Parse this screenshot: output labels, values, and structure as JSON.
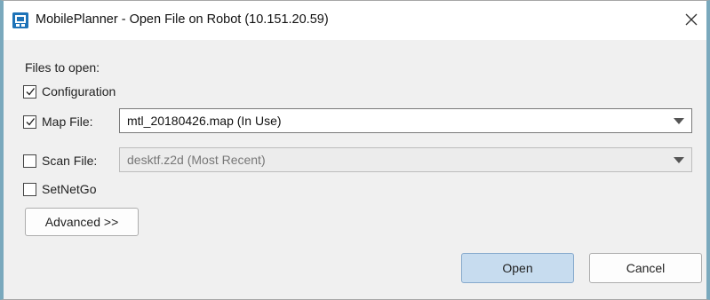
{
  "window": {
    "title": "MobilePlanner - Open File on Robot (10.151.20.59)",
    "close_glyph": "✕",
    "accent_color": "#7aa9bd",
    "app_icon": "mobileplanner-app-icon"
  },
  "form": {
    "files_label": "Files to open:",
    "configuration": {
      "label": "Configuration",
      "checked": true
    },
    "map_file": {
      "label": "Map File:",
      "checked": true,
      "value": "mtl_20180426.map  (In Use)"
    },
    "scan_file": {
      "label": "Scan File:",
      "checked": false,
      "value": "desktf.z2d  (Most Recent)",
      "disabled": true
    },
    "setnetgo": {
      "label": "SetNetGo",
      "checked": false
    },
    "advanced_label": "Advanced >>"
  },
  "actions": {
    "open_label": "Open",
    "cancel_label": "Cancel",
    "open_color": "#c7dcef"
  }
}
